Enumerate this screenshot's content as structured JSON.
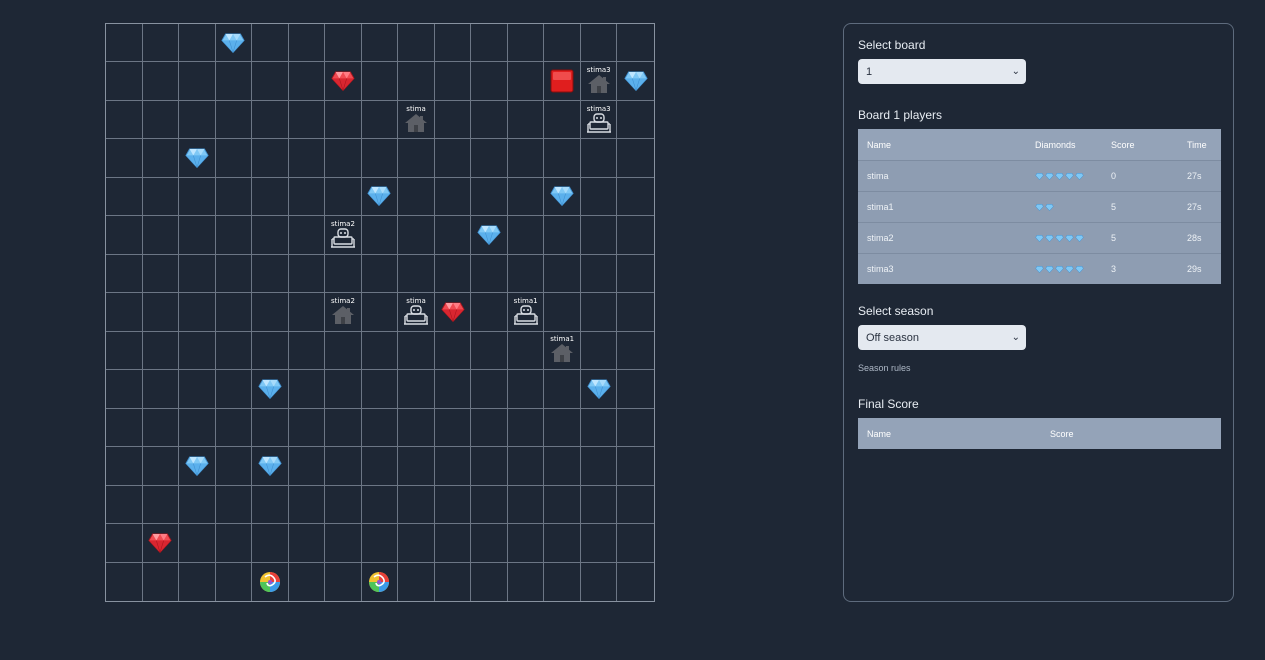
{
  "board": {
    "rows": 15,
    "cols": 15,
    "items": [
      {
        "r": 0,
        "c": 3,
        "type": "diamond-blue"
      },
      {
        "r": 1,
        "c": 6,
        "type": "diamond-red"
      },
      {
        "r": 1,
        "c": 12,
        "type": "red-button"
      },
      {
        "r": 1,
        "c": 13,
        "type": "base",
        "label": "stima3"
      },
      {
        "r": 1,
        "c": 14,
        "type": "diamond-blue"
      },
      {
        "r": 2,
        "c": 8,
        "type": "base",
        "label": "stima"
      },
      {
        "r": 2,
        "c": 13,
        "type": "bot",
        "label": "stima3"
      },
      {
        "r": 3,
        "c": 2,
        "type": "diamond-blue"
      },
      {
        "r": 4,
        "c": 7,
        "type": "diamond-blue"
      },
      {
        "r": 4,
        "c": 12,
        "type": "diamond-blue"
      },
      {
        "r": 5,
        "c": 6,
        "type": "bot",
        "label": "stima2"
      },
      {
        "r": 5,
        "c": 10,
        "type": "diamond-blue"
      },
      {
        "r": 7,
        "c": 6,
        "type": "base",
        "label": "stima2"
      },
      {
        "r": 7,
        "c": 8,
        "type": "bot",
        "label": "stima"
      },
      {
        "r": 7,
        "c": 9,
        "type": "diamond-red"
      },
      {
        "r": 7,
        "c": 11,
        "type": "bot",
        "label": "stima1"
      },
      {
        "r": 8,
        "c": 12,
        "type": "base",
        "label": "stima1"
      },
      {
        "r": 9,
        "c": 4,
        "type": "diamond-blue"
      },
      {
        "r": 9,
        "c": 13,
        "type": "diamond-blue"
      },
      {
        "r": 11,
        "c": 2,
        "type": "diamond-blue"
      },
      {
        "r": 11,
        "c": 4,
        "type": "diamond-blue"
      },
      {
        "r": 13,
        "c": 1,
        "type": "diamond-red"
      },
      {
        "r": 14,
        "c": 4,
        "type": "teleporter"
      },
      {
        "r": 14,
        "c": 7,
        "type": "teleporter"
      }
    ]
  },
  "panel": {
    "select_board_label": "Select board",
    "board_value": "1",
    "players_title": "Board 1 players",
    "players_table": {
      "headers": [
        "Name",
        "Diamonds",
        "Score",
        "Time"
      ],
      "rows": [
        {
          "name": "stima",
          "diamonds": 5,
          "score": "0",
          "time": "27s"
        },
        {
          "name": "stima1",
          "diamonds": 2,
          "score": "5",
          "time": "27s"
        },
        {
          "name": "stima2",
          "diamonds": 5,
          "score": "5",
          "time": "28s"
        },
        {
          "name": "stima3",
          "diamonds": 5,
          "score": "3",
          "time": "29s"
        }
      ]
    },
    "select_season_label": "Select season",
    "season_value": "Off season",
    "season_rules": "Season rules",
    "final_score_title": "Final Score",
    "final_table": {
      "headers": [
        "Name",
        "Score"
      ]
    }
  },
  "colors": {
    "background": "#1e2735",
    "table_header": "#94a3b8",
    "table_body": "#8e9db2",
    "diamond_blue": "#79c4f2",
    "diamond_red": "#e8323c"
  }
}
